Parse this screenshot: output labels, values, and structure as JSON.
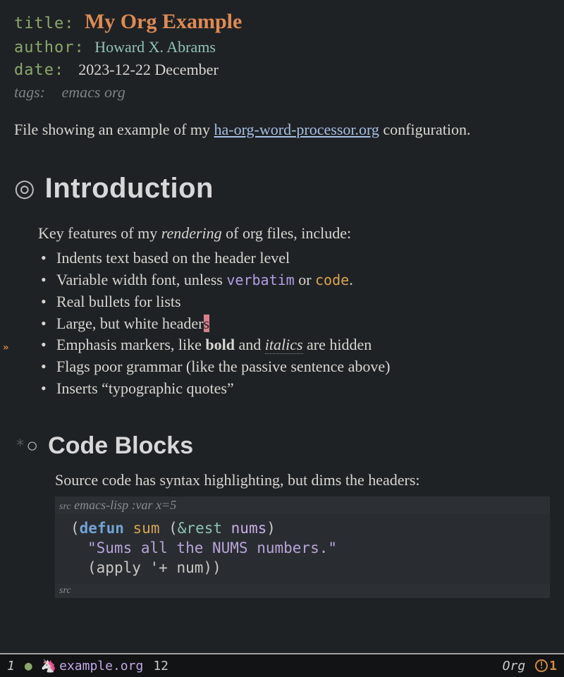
{
  "meta": {
    "title_key": "title",
    "title_val": "My Org Example",
    "author_key": "author",
    "author_val": "Howard X. Abrams",
    "date_key": "date",
    "date_val": "2023-12-22 December",
    "tags_key": "tags:",
    "tags_val": "emacs org"
  },
  "intro": {
    "pre": "File showing an example of my ",
    "link": "ha-org-word-processor.org",
    "post": " configuration."
  },
  "sections": {
    "intro_heading": "Introduction",
    "features_lead_pre": "Key features of my ",
    "features_lead_em": "rendering",
    "features_lead_post": " of org files, include:",
    "bullets": {
      "b0": "Indents text based on the header level",
      "b1_pre": "Variable width font, unless ",
      "b1_verb": "verbatim",
      "b1_mid": " or ",
      "b1_code": "code",
      "b1_post": ".",
      "b2": "Real bullets for lists",
      "b3_pre": "Large, but white header",
      "b3_cursor": "s",
      "b4_pre": "Emphasis markers, like ",
      "b4_bold": "bold",
      "b4_mid": " and ",
      "b4_ital": "italics",
      "b4_post": " are hidden",
      "b5": "Flags poor grammar (like the passive sentence above)",
      "b6": "Inserts “typographic quotes”"
    },
    "code_heading": "Code Blocks",
    "code_intro": "Source code has syntax highlighting, but dims the headers:"
  },
  "src": {
    "head_tag": "src",
    "head_rest": " emacs-lisp :var x=5",
    "line1": {
      "p1": "(",
      "kw": "defun",
      "sp1": " ",
      "fn": "sum",
      "sp2": " ",
      "p2": "(",
      "amp": "&rest",
      "sp3": " ",
      "arg": "nums",
      "p3": ")"
    },
    "line2": "\"Sums all the NUMS numbers.\"",
    "line3": {
      "p1": "(",
      "ap": "apply",
      "sp": " ",
      "q": "'+",
      "sp2": " ",
      "n": "num",
      "p2": "))"
    },
    "foot": "src"
  },
  "modeline": {
    "winno": "1",
    "filename": "example.org",
    "line": "12",
    "mode": "Org",
    "warn_count": "1"
  }
}
